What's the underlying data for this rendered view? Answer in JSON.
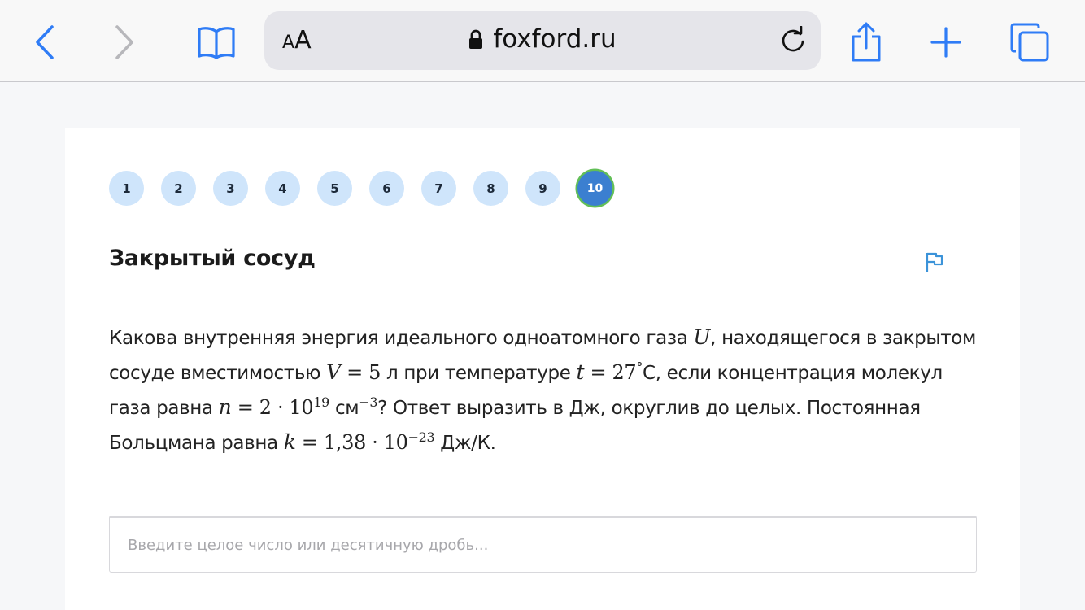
{
  "browser": {
    "text_size_small": "A",
    "text_size_big": "A",
    "url": "foxford.ru"
  },
  "pager": {
    "items": [
      "1",
      "2",
      "3",
      "4",
      "5",
      "6",
      "7",
      "8",
      "9",
      "10"
    ],
    "active": "10"
  },
  "task": {
    "title": "Закрытый сосуд",
    "question": {
      "p1": "Какова внутренняя энергия идеального одноатомного газа ",
      "U": "U",
      "p2": ", находящегося в закрытом сосуде вместимостью ",
      "V": "V",
      "eq1": " = 5",
      "p3": " л при температуре ",
      "t": "t",
      "eq2": " = 27",
      "deg": "°",
      "p4": "C, если концентрация молекул газа равна ",
      "n": "n",
      "eq3": " = 2 · 10",
      "exp1": "19",
      "p5": " см",
      "exp2": "−3",
      "p6": "? Ответ выразить в Дж, округлив до целых. Постоянная Больцмана равна ",
      "k": "k",
      "eq4": " = 1,38 · 10",
      "exp3": "−23",
      "p7": " Дж/К."
    },
    "answer_placeholder": "Введите целое число или десятичную дробь..."
  },
  "colors": {
    "accent": "#3b7fd0",
    "pager_bg": "#cfe5fb",
    "active_ring": "#62bf57",
    "ios_blue": "#2f7cf6"
  }
}
